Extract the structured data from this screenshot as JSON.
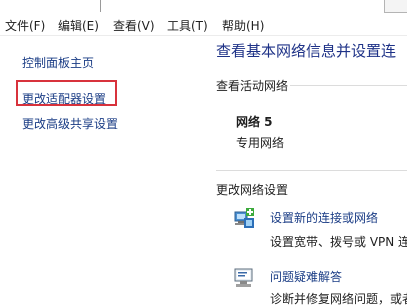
{
  "menubar": {
    "items": [
      "文件(F)",
      "编辑(E)",
      "查看(V)",
      "工具(T)",
      "帮助(H)"
    ]
  },
  "sidebar": {
    "items": [
      {
        "label": "控制面板主页"
      },
      {
        "label": "更改适配器设置"
      },
      {
        "label": "更改高级共享设置"
      }
    ]
  },
  "main": {
    "title": "查看基本网络信息并设置连",
    "active_networks_label": "查看活动网络",
    "network": {
      "name": "网络  5",
      "type": "专用网络"
    },
    "change_settings_label": "更改网络设置",
    "tasks": [
      {
        "title": "设置新的连接或网络",
        "description": "设置宽带、拨号或 VPN 连",
        "icon": "network-setup-icon"
      },
      {
        "title": "问题疑难解答",
        "description": "诊断并修复网络问题，或者",
        "icon": "troubleshoot-icon"
      }
    ]
  },
  "colors": {
    "link": "#1a3c85",
    "heading": "#1e3287",
    "highlight": "#d8323c"
  }
}
